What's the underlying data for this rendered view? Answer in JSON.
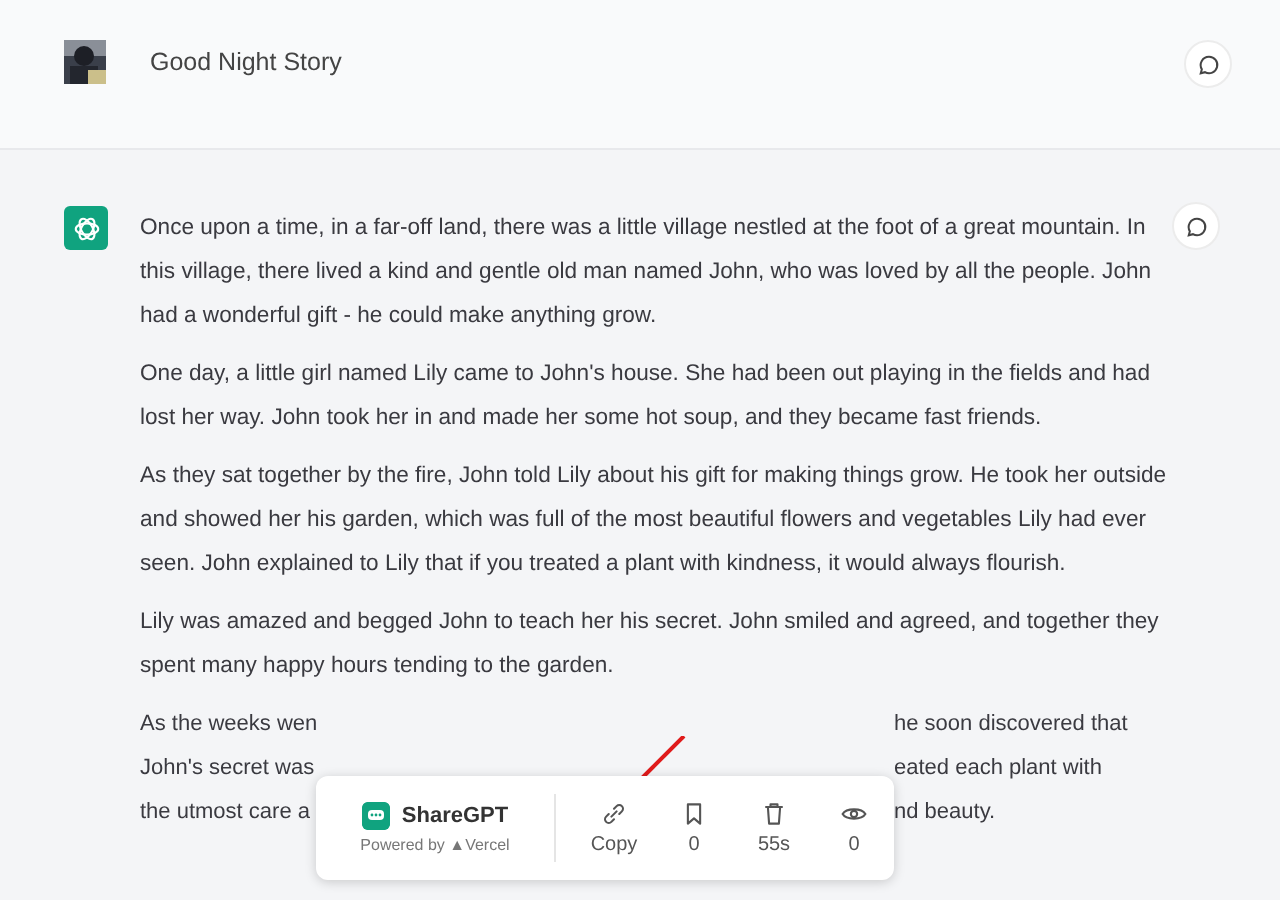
{
  "header": {
    "title": "Good Night Story"
  },
  "message": {
    "paragraphs": [
      "Once upon a time, in a far-off land, there was a little village nestled at the foot of a great mountain. In this village, there lived a kind and gentle old man named John, who was loved by all the people. John had a wonderful gift - he could make anything grow.",
      "One day, a little girl named Lily came to John's house. She had been out playing in the fields and had lost her way. John took her in and made her some hot soup, and they became fast friends.",
      "As they sat together by the fire, John told Lily about his gift for making things grow. He took her outside and showed her his garden, which was full of the most beautiful flowers and vegetables Lily had ever seen. John explained to Lily that if you treated a plant with kindness, it would always flourish.",
      "Lily was amazed and begged John to teach her his secret. John smiled and agreed, and together they spent many happy hours tending to the garden."
    ],
    "covered_lines": [
      {
        "left": "As the weeks wen",
        "right": "he soon discovered that"
      },
      {
        "left": "John's secret was",
        "right": "eated each plant with"
      },
      {
        "left": "the utmost care a",
        "right": "nd beauty."
      }
    ]
  },
  "share_bar": {
    "brand": "ShareGPT",
    "powered_by": "Powered by",
    "platform": "Vercel",
    "platform_mark": "▲",
    "actions": [
      {
        "kind": "link",
        "label": "Copy"
      },
      {
        "kind": "bookmark",
        "label": "0"
      },
      {
        "kind": "trash",
        "label": "55s"
      },
      {
        "kind": "eye",
        "label": "0"
      }
    ]
  }
}
